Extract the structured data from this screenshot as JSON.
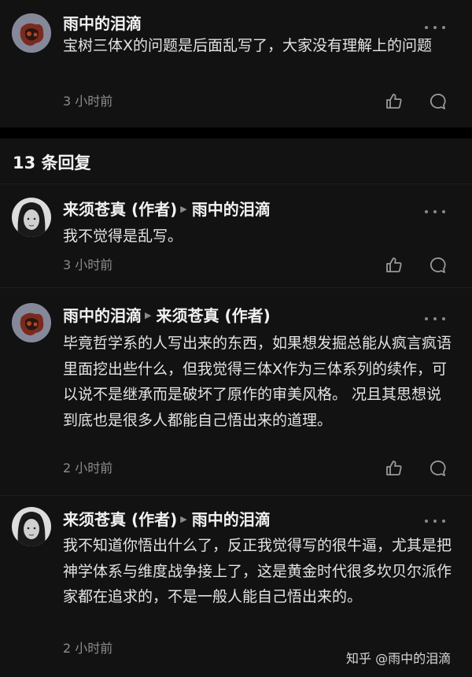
{
  "parent_comment": {
    "author": "雨中的泪滴",
    "text": "宝树三体Ⅹ的问题是后面乱写了，大家没有理解上的问题",
    "time": "3 小时前"
  },
  "replies_header": {
    "label": "13 条回复"
  },
  "replies": [
    {
      "author": "来须苍真",
      "author_tag": "(作者)",
      "reply_to": "雨中的泪滴",
      "reply_to_tag": "",
      "text": "我不觉得是乱写。",
      "time": "3 小时前"
    },
    {
      "author": "雨中的泪滴",
      "author_tag": "",
      "reply_to": "来须苍真",
      "reply_to_tag": "(作者)",
      "text": "毕竟哲学系的人写出来的东西，如果想发掘总能从疯言疯语里面挖出些什么，但我觉得三体Ⅹ作为三体系列的续作，可以说不是继承而是破坏了原作的审美风格。 况且其思想说到底也是很多人都能自己悟出来的道理。",
      "time": "2 小时前"
    },
    {
      "author": "来须苍真",
      "author_tag": "(作者)",
      "reply_to": "雨中的泪滴",
      "reply_to_tag": "",
      "text": "我不知道你悟出什么了，反正我觉得写的很牛逼，尤其是把神学体系与维度战争接上了，这是黄金时代很多坎贝尔派作家都在追求的，不是一般人能自己悟出来的。",
      "time": "2 小时前"
    }
  ],
  "watermark": {
    "text": "知乎 @雨中的泪滴"
  },
  "icons": {
    "like": "thumbs-up-icon",
    "reply": "speech-bubble-icon",
    "more": "more-dots-icon",
    "arrow": "reply-arrow-icon"
  },
  "colors": {
    "background": "#000000",
    "card": "#121212",
    "text": "#e6e6e6",
    "muted": "#8c8c8c"
  }
}
